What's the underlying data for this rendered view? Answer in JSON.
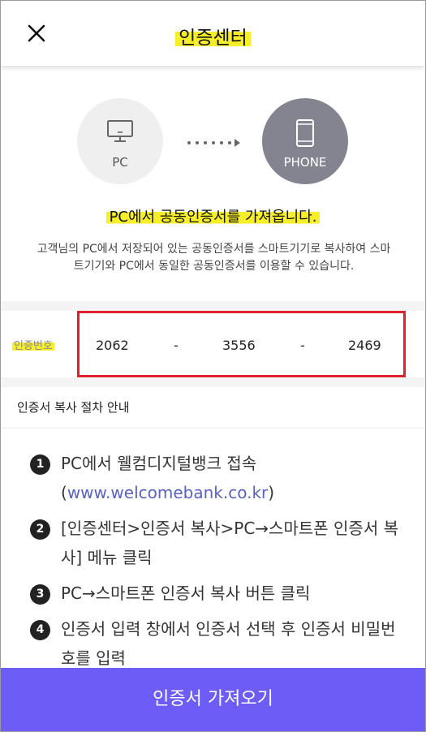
{
  "header": {
    "title": "인증센터",
    "close_icon": "close-icon"
  },
  "devices": {
    "source_label": "PC",
    "target_label": "PHONE",
    "source_icon": "monitor-icon",
    "target_icon": "smartphone-icon",
    "arrow_icon": "dotted-arrow-icon",
    "target_circle_color": "#848491"
  },
  "intro": {
    "headline": "PC에서 공동인증서를 가져옵니다.",
    "description": "고객님의 PC에서 저장되어 있는 공동인증서를 스마트기기로 복사하여 스마트기기와 PC에서 동일한 공동인증서를 이용할 수 있습니다."
  },
  "auth_code": {
    "label": "인증번호",
    "part1": "2062",
    "separator1": "-",
    "part2": "3556",
    "separator2": "-",
    "part3": "2469"
  },
  "guide": {
    "title": "인증서 복사 절차 안내",
    "steps": [
      {
        "num": "1",
        "text": "PC에서 웰컴디지털뱅크 접속",
        "link_prefix": "(",
        "link": "www.welcomebank.co.kr",
        "link_suffix": ")"
      },
      {
        "num": "2",
        "text": "[인증센터>인증서 복사>PC→스마트폰 인증서 복사] 메뉴 클릭"
      },
      {
        "num": "3",
        "text": "PC→스마트폰 인증서 복사 버튼 클릭"
      },
      {
        "num": "4",
        "text": "인증서 입력 창에서 인증서 선택 후 인증서 비밀번호를 입력"
      }
    ]
  },
  "cta": {
    "label": "인증서 가져오기",
    "color": "#6d5cf6"
  },
  "colors": {
    "highlight": "#f7ee2a",
    "code_box_border": "#e0202c"
  }
}
